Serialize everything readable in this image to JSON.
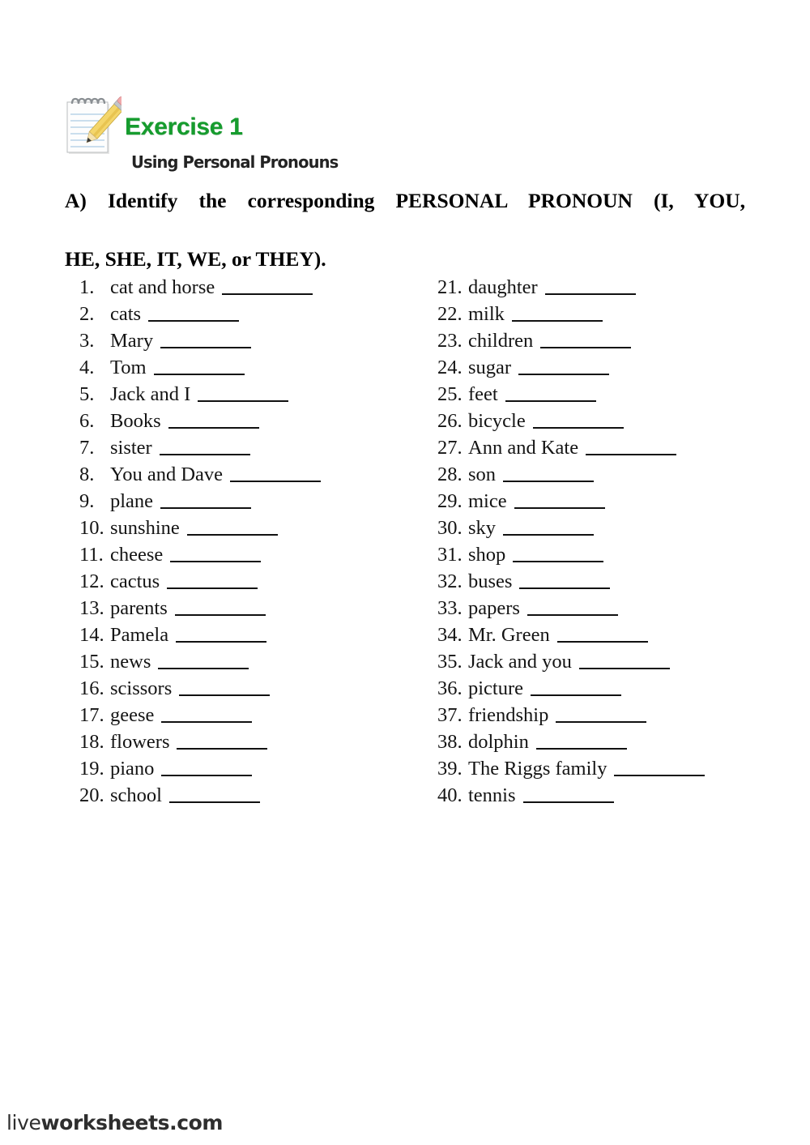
{
  "header": {
    "icon": "notepad-pencil-icon",
    "title": "Exercise 1",
    "subtitle": "Using Personal Pronouns",
    "title_color": "#169c2e",
    "subtitle_color": "#232323"
  },
  "instruction": {
    "line1": "A) Identify the corresponding PERSONAL PRONOUN (I, YOU,",
    "line2": "HE, SHE, IT, WE, or THEY)."
  },
  "questions": {
    "left": [
      {
        "num": "1.",
        "word": "cat and horse"
      },
      {
        "num": "2.",
        "word": "cats"
      },
      {
        "num": "3.",
        "word": "Mary"
      },
      {
        "num": "4.",
        "word": "Tom"
      },
      {
        "num": "5.",
        "word": "Jack and I"
      },
      {
        "num": "6.",
        "word": "Books"
      },
      {
        "num": "7.",
        "word": "sister"
      },
      {
        "num": "8.",
        "word": "You and Dave"
      },
      {
        "num": "9.",
        "word": "plane"
      },
      {
        "num": "10.",
        "word": "sunshine"
      },
      {
        "num": "11.",
        "word": "cheese"
      },
      {
        "num": "12.",
        "word": "cactus"
      },
      {
        "num": "13.",
        "word": "parents"
      },
      {
        "num": "14.",
        "word": "Pamela"
      },
      {
        "num": "15.",
        "word": "news"
      },
      {
        "num": "16.",
        "word": "scissors"
      },
      {
        "num": "17.",
        "word": "geese"
      },
      {
        "num": "18.",
        "word": "flowers"
      },
      {
        "num": "19.",
        "word": "piano"
      },
      {
        "num": "20.",
        "word": "school"
      }
    ],
    "right": [
      {
        "num": "21.",
        "word": "daughter"
      },
      {
        "num": "22.",
        "word": "milk"
      },
      {
        "num": "23.",
        "word": "children"
      },
      {
        "num": "24.",
        "word": "sugar"
      },
      {
        "num": "25.",
        "word": "feet"
      },
      {
        "num": "26.",
        "word": "bicycle"
      },
      {
        "num": "27.",
        "word": "Ann and Kate"
      },
      {
        "num": "28.",
        "word": "son"
      },
      {
        "num": "29.",
        "word": "mice"
      },
      {
        "num": "30.",
        "word": "sky"
      },
      {
        "num": "31.",
        "word": "shop"
      },
      {
        "num": "32.",
        "word": "buses"
      },
      {
        "num": "33.",
        "word": "papers"
      },
      {
        "num": "34.",
        "word": "Mr. Green"
      },
      {
        "num": "35.",
        "word": "Jack and you"
      },
      {
        "num": "36.",
        "word": "picture"
      },
      {
        "num": "37.",
        "word": "friendship"
      },
      {
        "num": "38.",
        "word": "dolphin"
      },
      {
        "num": "39.",
        "word": "The Riggs family"
      },
      {
        "num": "40.",
        "word": "tennis"
      }
    ]
  },
  "footer": {
    "brand_light": "live",
    "brand_heavy": "worksheets.com"
  }
}
